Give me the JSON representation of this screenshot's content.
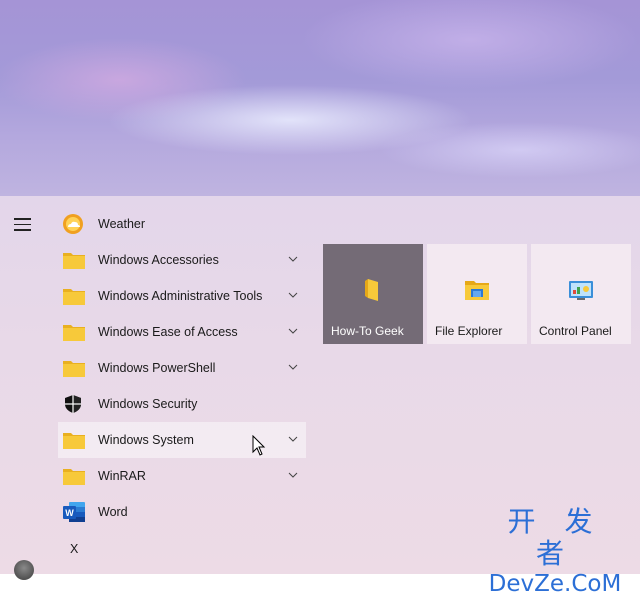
{
  "start_menu": {
    "apps": [
      {
        "label": "Weather",
        "icon": "weather-icon",
        "expandable": false
      },
      {
        "label": "Windows Accessories",
        "icon": "folder-icon",
        "expandable": true
      },
      {
        "label": "Windows Administrative Tools",
        "icon": "folder-icon",
        "expandable": true
      },
      {
        "label": "Windows Ease of Access",
        "icon": "folder-icon",
        "expandable": true
      },
      {
        "label": "Windows PowerShell",
        "icon": "folder-icon",
        "expandable": true
      },
      {
        "label": "Windows Security",
        "icon": "shield-icon",
        "expandable": false
      },
      {
        "label": "Windows System",
        "icon": "folder-icon",
        "expandable": true,
        "hovered": true
      },
      {
        "label": "WinRAR",
        "icon": "folder-icon",
        "expandable": true
      },
      {
        "label": "Word",
        "icon": "word-icon",
        "expandable": false
      }
    ],
    "letter_header": "X",
    "tiles": [
      {
        "label": "How-To Geek",
        "icon": "folder-icon",
        "style": "dark"
      },
      {
        "label": "File Explorer",
        "icon": "file-explorer-icon",
        "style": "light"
      },
      {
        "label": "Control Panel",
        "icon": "control-panel-icon",
        "style": "light"
      }
    ]
  },
  "watermark": {
    "top": "开 发 者",
    "bottom": "DevZe.CoM"
  },
  "colors": {
    "folder": "#f5c22c",
    "word": "#2b579a",
    "watermark": "#2c6fd6",
    "dark_tile": "#746b76"
  }
}
